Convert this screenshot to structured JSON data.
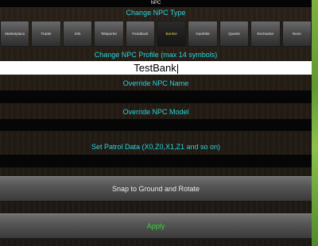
{
  "window": {
    "title": "NPC"
  },
  "npc_type": {
    "heading": "Change NPC Type",
    "options": [
      {
        "label": "Marketplace",
        "selected": false
      },
      {
        "label": "Trader",
        "selected": false
      },
      {
        "label": "Info",
        "selected": false
      },
      {
        "label": "Teleporter",
        "selected": false
      },
      {
        "label": "Feedback",
        "selected": false
      },
      {
        "label": "Banker",
        "selected": true
      },
      {
        "label": "Gambler",
        "selected": false
      },
      {
        "label": "Quests",
        "selected": false
      },
      {
        "label": "Enchanter",
        "selected": false
      },
      {
        "label": "None",
        "selected": false
      }
    ],
    "selected_color": "#e5d24a"
  },
  "profile": {
    "heading": "Change NPC Profile (max 14 symbols)",
    "value": "TestBank"
  },
  "override_name": {
    "heading": "Override NPC Name",
    "value": ""
  },
  "override_model": {
    "heading": "Override NPC Model",
    "value": ""
  },
  "patrol": {
    "heading": "Set Patrol Data (X0,Z0,X1,Z1 and so on)",
    "value": ""
  },
  "actions": {
    "snap_label": "Snap to Ground and Rotate",
    "apply_label": "Apply",
    "apply_color": "#3cd23c"
  },
  "colors": {
    "heading": "#29d4de",
    "background": "#231c15",
    "edge": "#6aa83a"
  }
}
